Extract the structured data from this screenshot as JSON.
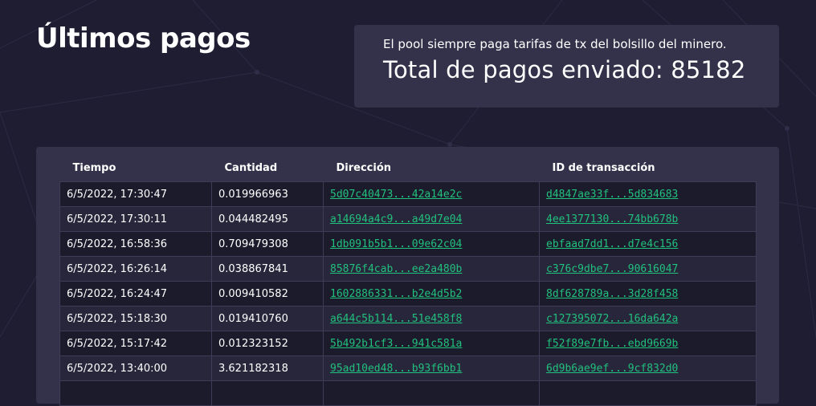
{
  "header": {
    "title": "Últimos pagos"
  },
  "info": {
    "note": "El pool siempre paga tarifas de tx del bolsillo del minero.",
    "total": "Total de pagos enviado: 85182"
  },
  "table": {
    "columns": [
      "Tiempo",
      "Cantidad",
      "Dirección",
      "ID de transacción"
    ],
    "rows": [
      {
        "time": "6/5/2022, 17:30:47",
        "amount": "0.019966963",
        "address": "5d07c40473...42a14e2c",
        "txid": "d4847ae33f...5d834683"
      },
      {
        "time": "6/5/2022, 17:30:11",
        "amount": "0.044482495",
        "address": "a14694a4c9...a49d7e04",
        "txid": "4ee1377130...74bb678b"
      },
      {
        "time": "6/5/2022, 16:58:36",
        "amount": "0.709479308",
        "address": "1db091b5b1...09e62c04",
        "txid": "ebfaad7dd1...d7e4c156"
      },
      {
        "time": "6/5/2022, 16:26:14",
        "amount": "0.038867841",
        "address": "85876f4cab...ee2a480b",
        "txid": "c376c9dbe7...90616047"
      },
      {
        "time": "6/5/2022, 16:24:47",
        "amount": "0.009410582",
        "address": "1602886331...b2e4d5b2",
        "txid": "8df628789a...3d28f458"
      },
      {
        "time": "6/5/2022, 15:18:30",
        "amount": "0.019410760",
        "address": "a644c5b114...51e458f8",
        "txid": "c127395072...16da642a"
      },
      {
        "time": "6/5/2022, 15:17:42",
        "amount": "0.012323152",
        "address": "5b492b1cf3...941c581a",
        "txid": "f52f89e7fb...ebd9669b"
      },
      {
        "time": "6/5/2022, 13:40:00",
        "amount": "3.621182318",
        "address": "95ad10ed48...b93f6bb1",
        "txid": "6d9b6ae9ef...9cf832d0"
      },
      {
        "time": "",
        "amount": "",
        "address": "",
        "txid": ""
      }
    ]
  },
  "colors": {
    "background": "#1e1d32",
    "panel": "#34324a",
    "row_dark": "#1c1b2c",
    "row_light": "#27263b",
    "link": "#22c07d"
  }
}
